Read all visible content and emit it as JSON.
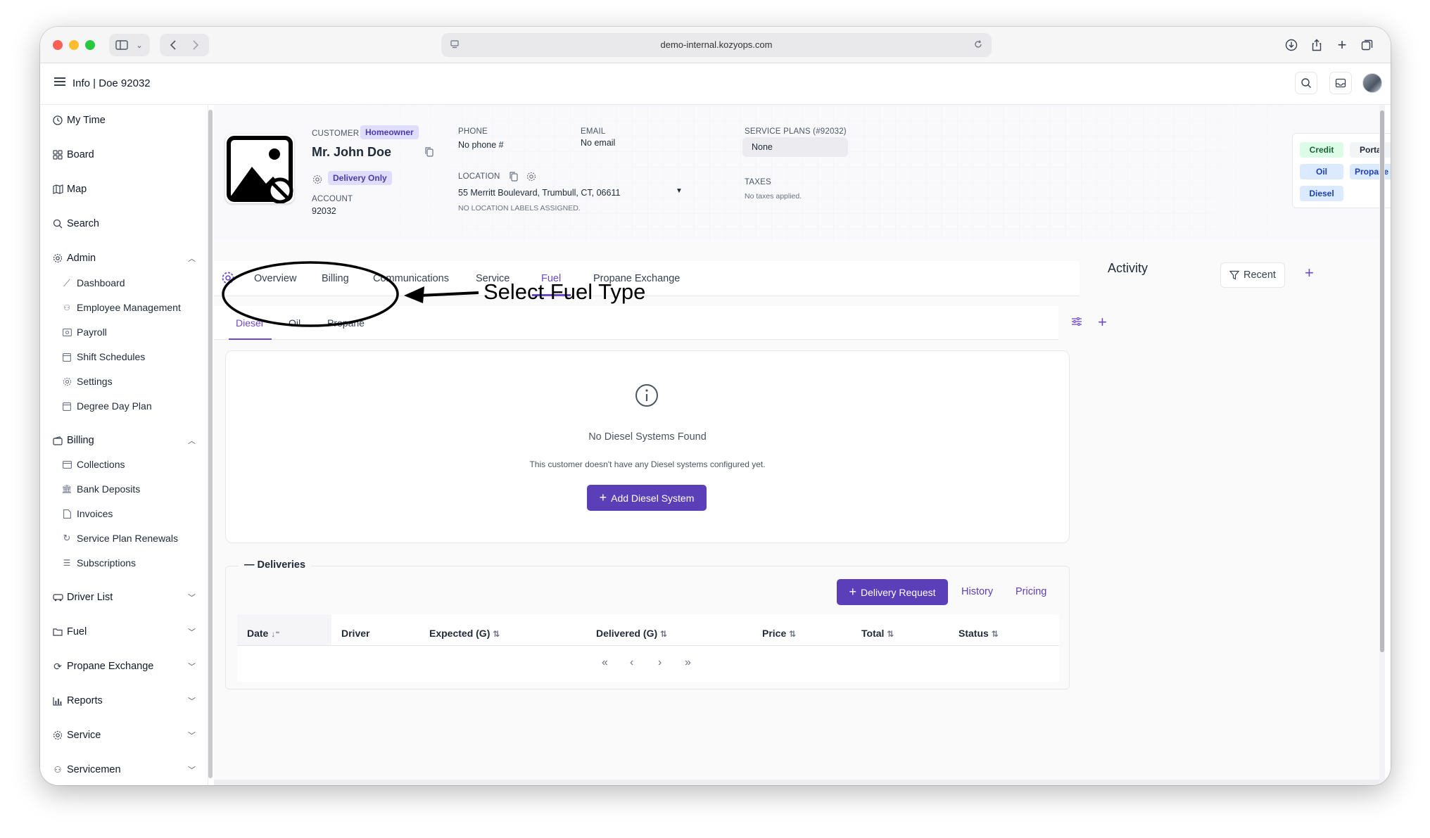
{
  "browser": {
    "url": "demo-internal.kozyops.com"
  },
  "header": {
    "title": "Info | Doe 92032"
  },
  "sidebar": {
    "items": [
      {
        "label": "My Time",
        "icon": "clock-icon"
      },
      {
        "label": "Board",
        "icon": "grid-icon"
      },
      {
        "label": "Map",
        "icon": "map-icon"
      },
      {
        "label": "Search",
        "icon": "search-icon"
      }
    ],
    "admin": {
      "label": "Admin",
      "children": [
        "Dashboard",
        "Employee Management",
        "Payroll",
        "Shift Schedules",
        "Settings",
        "Degree Day Plan"
      ]
    },
    "billing": {
      "label": "Billing",
      "children": [
        "Collections",
        "Bank Deposits",
        "Invoices",
        "Service Plan Renewals",
        "Subscriptions"
      ]
    },
    "collapsed": [
      "Driver List",
      "Fuel",
      "Propane Exchange",
      "Reports",
      "Service",
      "Servicemen"
    ]
  },
  "customer": {
    "label": "CUSTOMER",
    "type_badge": "Homeowner",
    "name": "Mr. John Doe",
    "delivery_badge": "Delivery Only",
    "account_label": "ACCOUNT",
    "account": "92032",
    "phone_label": "PHONE",
    "phone": "No phone #",
    "email_label": "EMAIL",
    "email": "No email",
    "location_label": "LOCATION",
    "location": "55 Merritt Boulevard, Trumbull, CT, 06611",
    "location_note": "NO LOCATION LABELS ASSIGNED.",
    "plans_label": "SERVICE PLANS (#92032)",
    "plans": "None",
    "taxes_label": "TAXES",
    "taxes": "No taxes applied."
  },
  "tags": [
    "Credit",
    "Portal",
    "Oil",
    "Propane",
    "Diesel"
  ],
  "tabs": [
    "Overview",
    "Billing",
    "Communications",
    "Service",
    "Fuel",
    "Propane Exchange"
  ],
  "active_tab": "Fuel",
  "fuel_tabs": [
    "Diesel",
    "Oil",
    "Propane"
  ],
  "active_fuel_tab": "Diesel",
  "annotation": "Select Fuel Type",
  "empty_state": {
    "title": "No Diesel Systems Found",
    "subtitle": "This customer doesn't have any Diesel systems configured yet.",
    "button": "Add Diesel System"
  },
  "deliveries": {
    "title": "Deliveries",
    "request_button": "Delivery Request",
    "history": "History",
    "pricing": "Pricing",
    "columns": [
      "Date",
      "Driver",
      "Expected (G)",
      "Delivered (G)",
      "Price",
      "Total",
      "Status"
    ]
  },
  "activity": {
    "title": "Activity",
    "filter": "Recent"
  },
  "colors": {
    "accent": "#6d4ac9",
    "primary_button": "#5b3fb8"
  }
}
